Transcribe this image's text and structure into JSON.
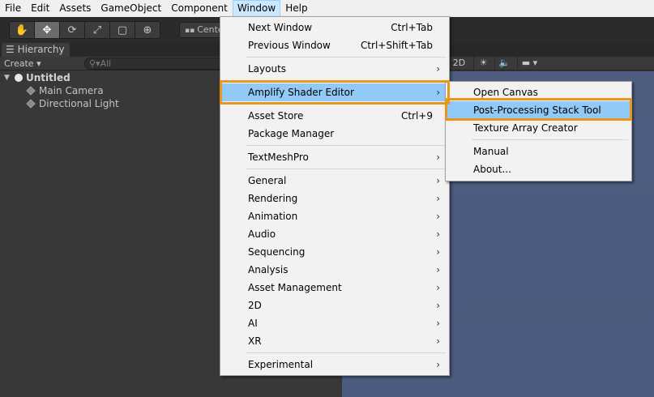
{
  "menubar": {
    "items": [
      "File",
      "Edit",
      "Assets",
      "GameObject",
      "Component",
      "Window",
      "Help"
    ]
  },
  "toolbar": {
    "tool_icons": [
      "hand-icon",
      "move-icon",
      "rotate-icon",
      "scale-icon",
      "rect-icon",
      "transform-icon"
    ],
    "pivot_label": "Cente"
  },
  "hierarchy": {
    "tab_label": "Hierarchy",
    "create_label": "Create",
    "search_placeholder": "All",
    "scene_name": "Untitled",
    "objects": [
      "Main Camera",
      "Directional Light"
    ]
  },
  "scene_toolbar": {
    "mode_2d": "2D"
  },
  "window_menu": {
    "items": [
      {
        "label": "Next Window",
        "shortcut": "Ctrl+Tab"
      },
      {
        "label": "Previous Window",
        "shortcut": "Ctrl+Shift+Tab"
      },
      {
        "label": "Layouts"
      },
      {
        "label": "Amplify Shader Editor"
      },
      {
        "label": "Asset Store",
        "shortcut": "Ctrl+9"
      },
      {
        "label": "Package Manager"
      },
      {
        "label": "TextMeshPro"
      },
      {
        "label": "General"
      },
      {
        "label": "Rendering"
      },
      {
        "label": "Animation"
      },
      {
        "label": "Audio"
      },
      {
        "label": "Sequencing"
      },
      {
        "label": "Analysis"
      },
      {
        "label": "Asset Management"
      },
      {
        "label": "2D"
      },
      {
        "label": "AI"
      },
      {
        "label": "XR"
      },
      {
        "label": "Experimental"
      }
    ]
  },
  "submenu": {
    "items": [
      {
        "label": "Open Canvas"
      },
      {
        "label": "Post-Processing Stack Tool"
      },
      {
        "label": "Texture Array Creator"
      },
      {
        "label": "Manual"
      },
      {
        "label": "About..."
      }
    ]
  },
  "colors": {
    "highlight": "#91c9f7",
    "callout": "#e8961c",
    "menu_background": "#f2f2f2",
    "editor_dark": "#383838"
  }
}
